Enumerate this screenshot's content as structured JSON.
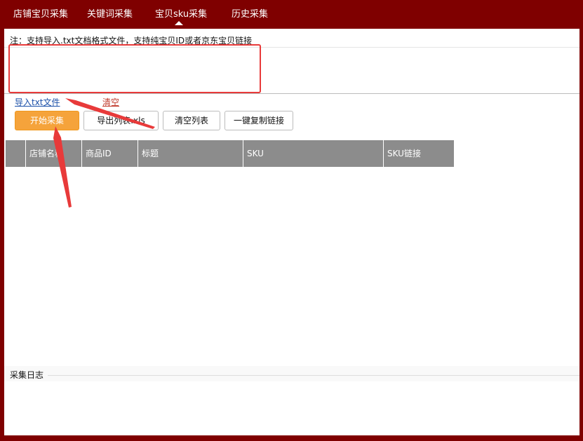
{
  "tabs": [
    {
      "label": "店铺宝贝采集"
    },
    {
      "label": "关键词采集"
    },
    {
      "label": "宝贝sku采集",
      "active": true
    },
    {
      "label": "历史采集"
    }
  ],
  "note": "注：支持导入.txt文档格式文件，支持纯宝贝ID或者京东宝贝链接",
  "links": {
    "import_txt": "导入txt文件",
    "clear": "清空"
  },
  "buttons": {
    "start": "开始采集",
    "export": "导出列表.xls",
    "clear_list": "清空列表",
    "copy_links": "一键复制链接"
  },
  "table": {
    "columns": [
      "",
      "店铺名称",
      "商品ID",
      "标题",
      "SKU",
      "SKU链接"
    ],
    "rows": []
  },
  "log": {
    "title": "采集日志"
  },
  "colors": {
    "frame": "#7f0000",
    "primary_button": "#f5a33b",
    "table_header": "#8c8c8c",
    "link": "#1a4fa8",
    "clear_link": "#c0392b",
    "annotation": "#e83a3a"
  }
}
